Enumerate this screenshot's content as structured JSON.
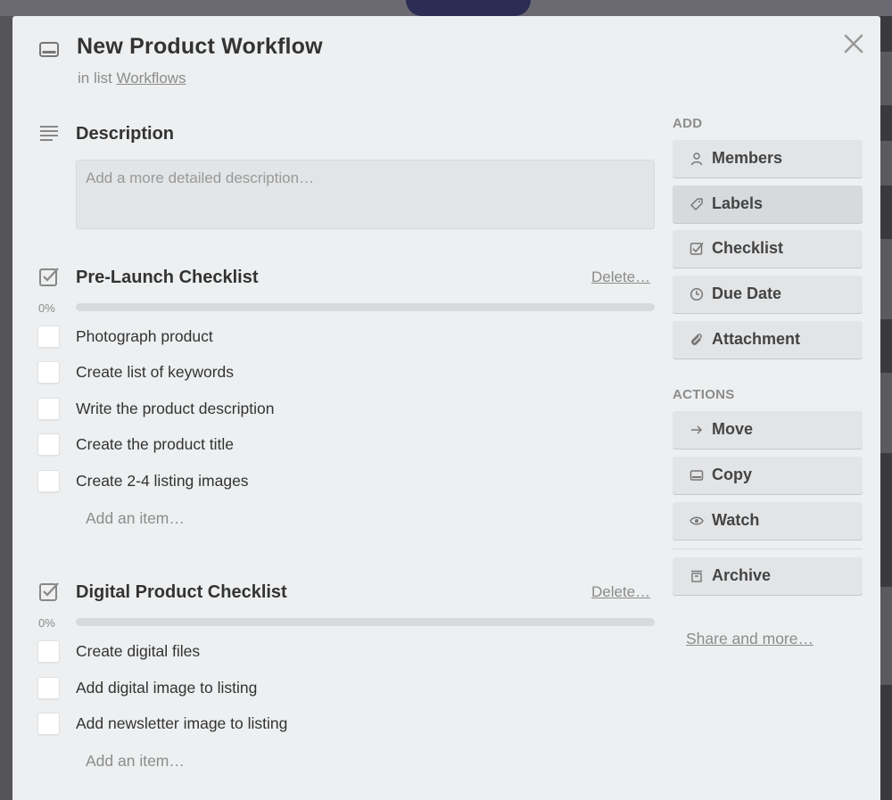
{
  "card": {
    "title": "New Product Workflow",
    "in_list_prefix": "in list",
    "list_name": "Workflows"
  },
  "description": {
    "heading": "Description",
    "placeholder": "Add a more detailed description…"
  },
  "checklists": [
    {
      "title": "Pre-Launch Checklist",
      "delete_label": "Delete…",
      "progress_label": "0%",
      "progress": 0,
      "items": [
        {
          "text": "Photograph product",
          "checked": false
        },
        {
          "text": "Create list of keywords",
          "checked": false
        },
        {
          "text": "Write the product description",
          "checked": false
        },
        {
          "text": "Create the product title",
          "checked": false
        },
        {
          "text": "Create 2-4 listing images",
          "checked": false
        }
      ],
      "add_item_label": "Add an item…"
    },
    {
      "title": "Digital Product Checklist",
      "delete_label": "Delete…",
      "progress_label": "0%",
      "progress": 0,
      "items": [
        {
          "text": "Create digital files",
          "checked": false
        },
        {
          "text": "Add digital image to listing",
          "checked": false
        },
        {
          "text": "Add newsletter image to listing",
          "checked": false
        }
      ],
      "add_item_label": "Add an item…"
    }
  ],
  "sidebar": {
    "add_heading": "Add",
    "add_buttons": [
      {
        "label": "Members",
        "icon": "person-icon"
      },
      {
        "label": "Labels",
        "icon": "tag-icon",
        "active": true
      },
      {
        "label": "Checklist",
        "icon": "checkbox-icon"
      },
      {
        "label": "Due Date",
        "icon": "clock-icon"
      },
      {
        "label": "Attachment",
        "icon": "paperclip-icon"
      }
    ],
    "actions_heading": "Actions",
    "action_buttons": [
      {
        "label": "Move",
        "icon": "arrow-right-icon"
      },
      {
        "label": "Copy",
        "icon": "card-icon"
      },
      {
        "label": "Watch",
        "icon": "eye-icon"
      }
    ],
    "archive_button": {
      "label": "Archive",
      "icon": "archive-icon"
    },
    "share_label": "Share and more…"
  },
  "colors": {
    "modal_bg": "#edeff0",
    "button_bg": "#e2e4e6",
    "muted_text": "#8c8c8c",
    "text": "#333333"
  }
}
